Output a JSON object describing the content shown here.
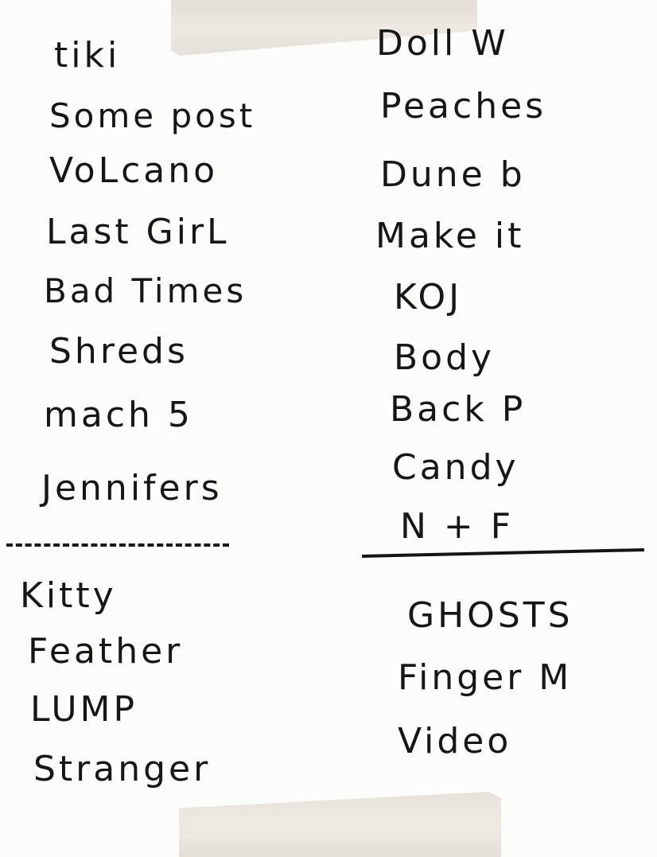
{
  "setlist": {
    "left": [
      "tiki",
      "Some post",
      "VoLcano",
      "Last GirL",
      "Bad Times",
      "Shreds",
      "mach 5",
      "Jennifers"
    ],
    "left_extra": [
      "Kitty",
      "Feather",
      "LUMP",
      "Stranger"
    ],
    "right": [
      "Doll W",
      "Peaches",
      "Dune b",
      "Make it",
      "KOJ",
      "Body",
      "Back P",
      "Candy",
      "N + F"
    ],
    "right_extra": [
      "GHOSTS",
      "Finger M",
      "Video"
    ]
  }
}
